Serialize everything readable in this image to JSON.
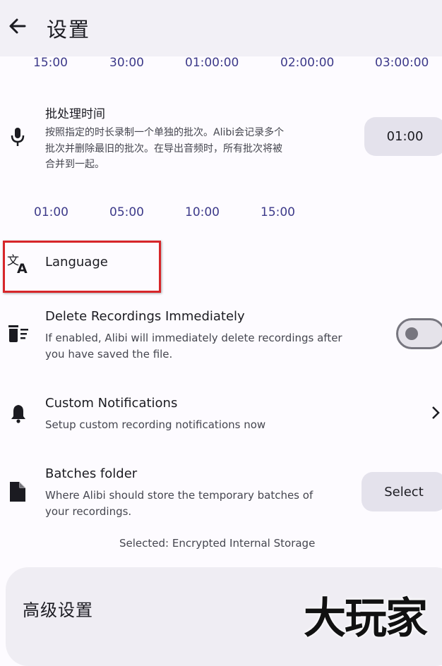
{
  "header": {
    "title": "设置",
    "back_icon": "arrow-left-icon"
  },
  "duration_chips_top": [
    "15:00",
    "30:00",
    "01:00:00",
    "02:00:00",
    "03:00:00"
  ],
  "batch_time": {
    "title": "批处理时间",
    "description_lines": [
      "按照指定的时长录制一个单独的批次。Alibi会记录多个",
      "批次并删除最旧的批次。在导出音频时，所有批次将被",
      "合并到一起。"
    ],
    "value": "01:00",
    "icon": "microphone-icon"
  },
  "batch_chips": [
    "01:00",
    "05:00",
    "10:00",
    "15:00"
  ],
  "language": {
    "title": "Language",
    "icon": "translate-icon",
    "highlight_color": "#d7262a"
  },
  "delete_recordings": {
    "title": "Delete Recordings Immediately",
    "description_lines": [
      "If enabled, Alibi will immediately delete recordings after",
      "you have saved the file."
    ],
    "enabled": false,
    "icon": "delete-sweep-icon"
  },
  "custom_notifications": {
    "title": "Custom Notifications",
    "description": "Setup custom recording notifications now",
    "icon": "bell-icon",
    "chevron": "chevron-right-icon"
  },
  "batches_folder": {
    "title": "Batches folder",
    "description_lines": [
      "Where Alibi should store the temporary batches of",
      "your recordings."
    ],
    "button_label": "Select",
    "selected_text": "Selected: Encrypted Internal Storage",
    "icon": "file-icon"
  },
  "advanced": {
    "title": "高级设置"
  },
  "watermark": {
    "text": "大玩家"
  },
  "colors": {
    "accent_text": "#3d3a8a",
    "button_bg": "#e4e2ec",
    "background": "#fdfbff"
  }
}
